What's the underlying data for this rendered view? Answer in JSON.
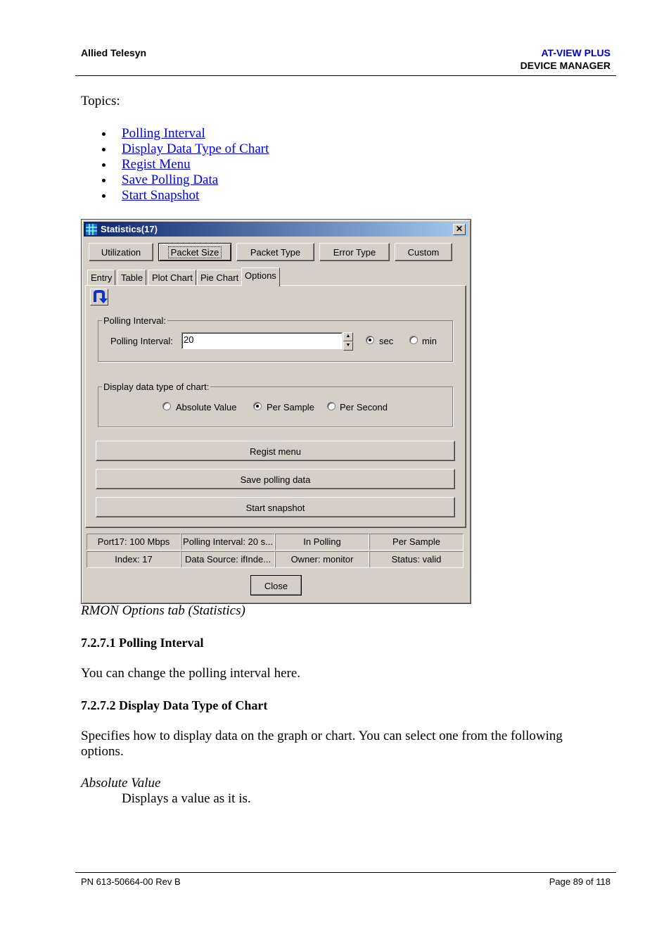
{
  "header": {
    "company": "Allied Telesyn",
    "product": "AT-VIEW PLUS",
    "section": "DEVICE MANAGER"
  },
  "topics_label": "Topics:",
  "topics": [
    "Polling Interval",
    "Display Data Type of Chart",
    "Regist Menu",
    "Save Polling Data",
    "Start Snapshot"
  ],
  "dialog": {
    "title": "Statistics(17)",
    "top_buttons": [
      "Utilization",
      "Packet Size",
      "Packet Type",
      "Error Type",
      "Custom"
    ],
    "tabs": [
      "Entry",
      "Table",
      "Plot Chart",
      "Pie Chart",
      "Options"
    ],
    "polling_group": "Polling Interval:",
    "polling_label": "Polling Interval:",
    "polling_value": "20",
    "unit_sec": "sec",
    "unit_min": "min",
    "display_group": "Display data type of chart:",
    "opt_absolute": "Absolute Value",
    "opt_sample": "Per Sample",
    "opt_second": "Per Second",
    "regist_button": "Regist menu",
    "save_button": "Save polling data",
    "snapshot_button": "Start snapshot",
    "status_row1": [
      "Port17: 100 Mbps",
      "Polling Interval: 20 s...",
      "In Polling",
      "Per Sample"
    ],
    "status_row2": [
      "Index: 17",
      "Data Source: ifInde...",
      "Owner: monitor",
      "Status: valid"
    ],
    "close_button": "Close"
  },
  "caption": "RMON Options tab (Statistics)",
  "s1_heading": "7.2.7.1 Polling Interval",
  "s1_text": "You can change the polling interval here.",
  "s2_heading": "7.2.7.2 Display Data Type of Chart",
  "s2_text_1": "Specifies how to display data on the graph or chart. You can select one from the following",
  "s2_text_2": "options.",
  "term": "Absolute Value",
  "term_desc": "Displays a value as it is.",
  "footer": {
    "left": "PN 613-50664-00 Rev B",
    "right": "Page 89 of 118"
  }
}
